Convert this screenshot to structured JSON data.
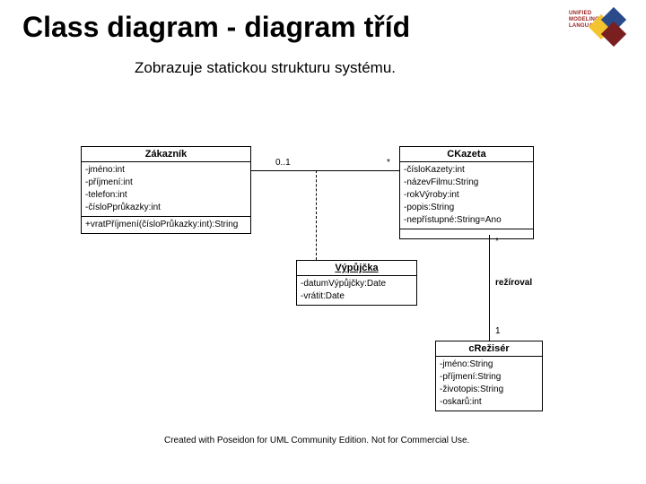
{
  "header": {
    "title": "Class diagram - diagram tříd",
    "subtitle": "Zobrazuje statickou strukturu systému.",
    "logo_tag": "UNIFIED\nMODELING\nLANGUAGE"
  },
  "classes": {
    "zakaznik": {
      "name": "Zákazník",
      "attrs": [
        "-jméno:int",
        "-příjmení:int",
        "-telefon:int",
        "-čísloPprůkazky:int"
      ],
      "ops": [
        "+vratPříjmení(čísloPrůkazky:int):String"
      ]
    },
    "ckazeta": {
      "name": "CKazeta",
      "attrs": [
        "-čísloKazety:int",
        "-názevFilmu:String",
        "-rokVýroby:int",
        "-popis:String",
        "-nepřístupné:String=Ano"
      ],
      "ops": []
    },
    "vypujcka": {
      "name": "Výpůjčka",
      "attrs": [
        "-datumVýpůjčky:Date",
        "-vrátit:Date"
      ],
      "ops": []
    },
    "reziser": {
      "name": "cRežisér",
      "attrs": [
        "-jméno:String",
        "-příjmení:String",
        "-životopis:String",
        "-oskarů:int"
      ],
      "ops": []
    }
  },
  "multiplicities": {
    "zak_assoc": "0..1",
    "kaz_assoc": "*",
    "kaz_rez_top": "*",
    "kaz_rez_bottom": "1"
  },
  "assoc_labels": {
    "reziroval": "režíroval"
  },
  "footer": "Created with Poseidon for UML Community Edition. Not for Commercial Use."
}
